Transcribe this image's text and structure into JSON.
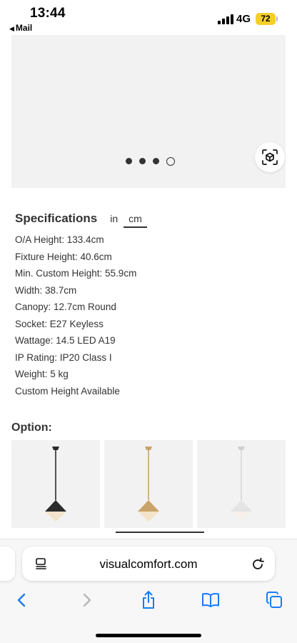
{
  "status_bar": {
    "time": "13:44",
    "back_app": "Mail",
    "network": "4G",
    "battery": "72"
  },
  "gallery": {
    "ar_icon": "ar-cube-icon",
    "dots": [
      {
        "state": "filled"
      },
      {
        "state": "filled"
      },
      {
        "state": "filled"
      },
      {
        "state": "open"
      }
    ]
  },
  "specifications": {
    "title": "Specifications",
    "unit_in": "in",
    "unit_cm": "cm",
    "selected_unit": "cm",
    "items": [
      "O/A Height: 133.4cm",
      "Fixture Height: 40.6cm",
      "Min. Custom Height: 55.9cm",
      "Width: 38.7cm",
      "Canopy: 12.7cm Round",
      "Socket: E27 Keyless",
      "Wattage: 14.5 LED A19",
      "IP Rating: IP20 Class I",
      "Weight: 5 kg",
      "Custom Height Available"
    ]
  },
  "options": {
    "title": "Option:",
    "items": [
      {
        "finish": "black",
        "color": "#2b2b2b"
      },
      {
        "finish": "brass",
        "color": "#c9a46a",
        "selected": true
      },
      {
        "finish": "white",
        "color": "#e4e4e4"
      }
    ]
  },
  "browser": {
    "url": "visualcomfort.com",
    "icons": [
      "reader-mode-icon",
      "reload-icon",
      "back-icon",
      "forward-icon",
      "share-icon",
      "bookmarks-icon",
      "tabs-icon"
    ],
    "accent": "#1a7cf5"
  }
}
